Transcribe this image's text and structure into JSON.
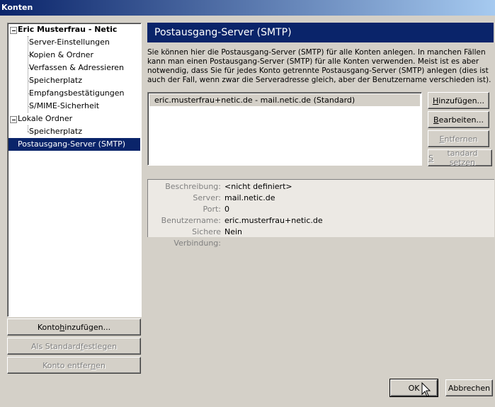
{
  "window": {
    "title": "Konten"
  },
  "tree": {
    "account_name": "Eric Musterfrau - Netic",
    "account_children": [
      "Server-Einstellungen",
      "Kopien & Ordner",
      "Verfassen & Adressieren",
      "Speicherplatz",
      "Empfangsbestätigungen",
      "S/MIME-Sicherheit"
    ],
    "local_folders": "Lokale Ordner",
    "local_children": [
      "Speicherplatz"
    ],
    "outgoing": "Postausgang-Server (SMTP)"
  },
  "left_buttons": {
    "add_account": {
      "pre": "Konto ",
      "accel": "h",
      "post": "inzufügen..."
    },
    "set_default": {
      "pre": "Als Standard ",
      "accel": "f",
      "post": "estlegen"
    },
    "remove_account": {
      "pre": "Konto entfer",
      "accel": "n",
      "post": "en"
    }
  },
  "panel": {
    "title": "Postausgang-Server (SMTP)",
    "description": "Sie können hier die Postausgang-Server (SMTP) für alle Konten anlegen. In manchen Fällen kann man einen Postausgang-Server (SMTP) für alle Konten verwenden. Meist ist es aber notwendig, dass Sie für jedes Konto getrennte Postausgang-Server (SMTP) anlegen (dies ist auch der Fall, wenn zwar die Serveradresse gleich, aber der Benutzername verschieden ist).",
    "servers": [
      "eric.musterfrau+netic.de - mail.netic.de (Standard)"
    ]
  },
  "server_buttons": {
    "add": {
      "pre": "",
      "accel": "H",
      "post": "inzufügen..."
    },
    "edit": {
      "pre": "",
      "accel": "B",
      "post": "earbeiten..."
    },
    "remove": {
      "pre": "",
      "accel": "E",
      "post": "ntfernen"
    },
    "set_default": {
      "pre": "",
      "accel": "S",
      "post": "tandard setzen"
    }
  },
  "details": {
    "description_label": "Beschreibung:",
    "description_value": "<nicht definiert>",
    "server_label": "Server:",
    "server_value": "mail.netic.de",
    "port_label": "Port:",
    "port_value": "0",
    "username_label": "Benutzername:",
    "username_value": "eric.musterfrau+netic.de",
    "secure_label": "Sichere Verbindung:",
    "secure_value": "Nein"
  },
  "dialog_buttons": {
    "ok": "OK",
    "cancel": "Abbrechen"
  },
  "colors": {
    "accent": "#0a246a",
    "face": "#d4d0c8"
  }
}
